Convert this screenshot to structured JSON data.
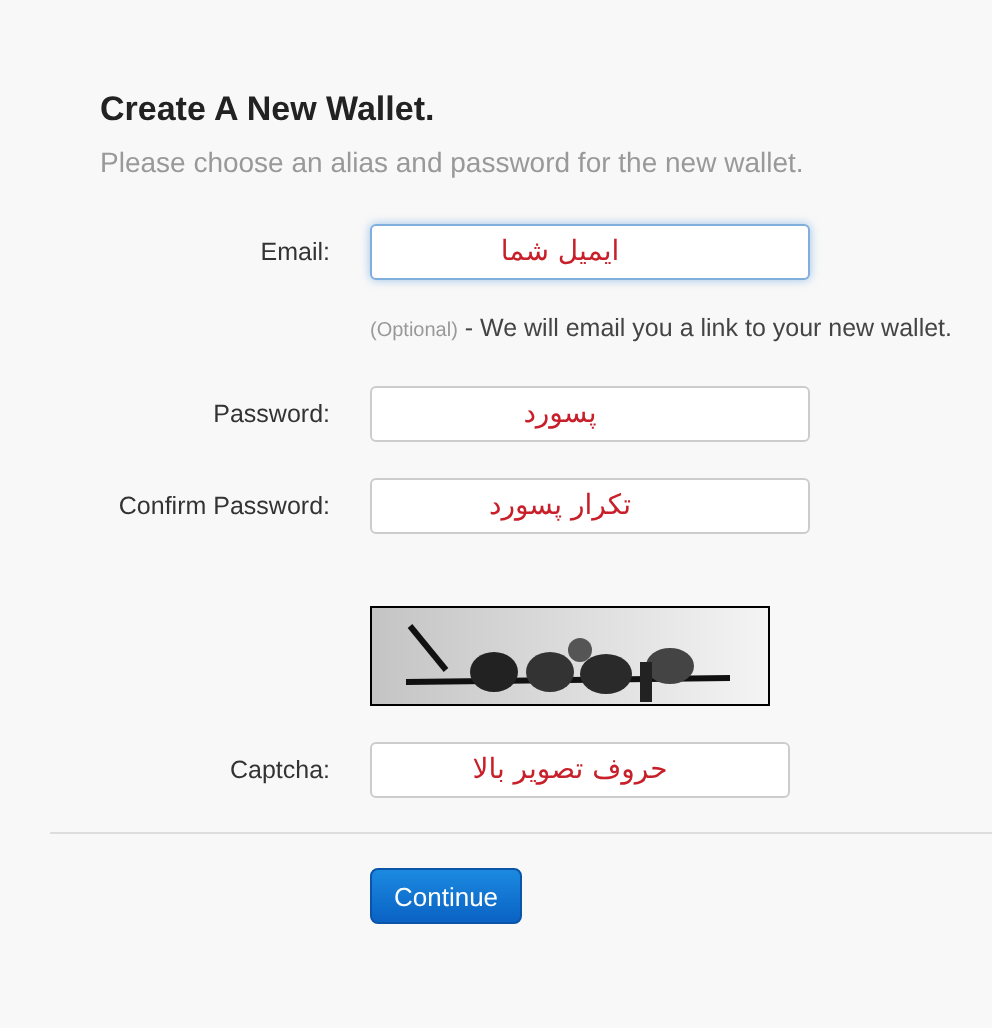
{
  "heading": "Create A New Wallet.",
  "subtitle": "Please choose an alias and password for the new wallet.",
  "rows": [
    {
      "kind": "field",
      "label": "Email:",
      "value": "ایمیل شما",
      "focused": true
    },
    {
      "kind": "help",
      "note": "(Optional)",
      "text": "- We will email you a link to your new wallet."
    },
    {
      "kind": "field",
      "label": "Password:",
      "value": "پسورد",
      "focused": false
    },
    {
      "kind": "field",
      "label": "Confirm Password:",
      "value": "تکرار پسورد",
      "focused": false
    },
    {
      "kind": "captcha_image"
    },
    {
      "kind": "field",
      "label": "Captcha:",
      "value": "حروف تصویر بالا",
      "focused": false
    }
  ],
  "button": "Continue"
}
